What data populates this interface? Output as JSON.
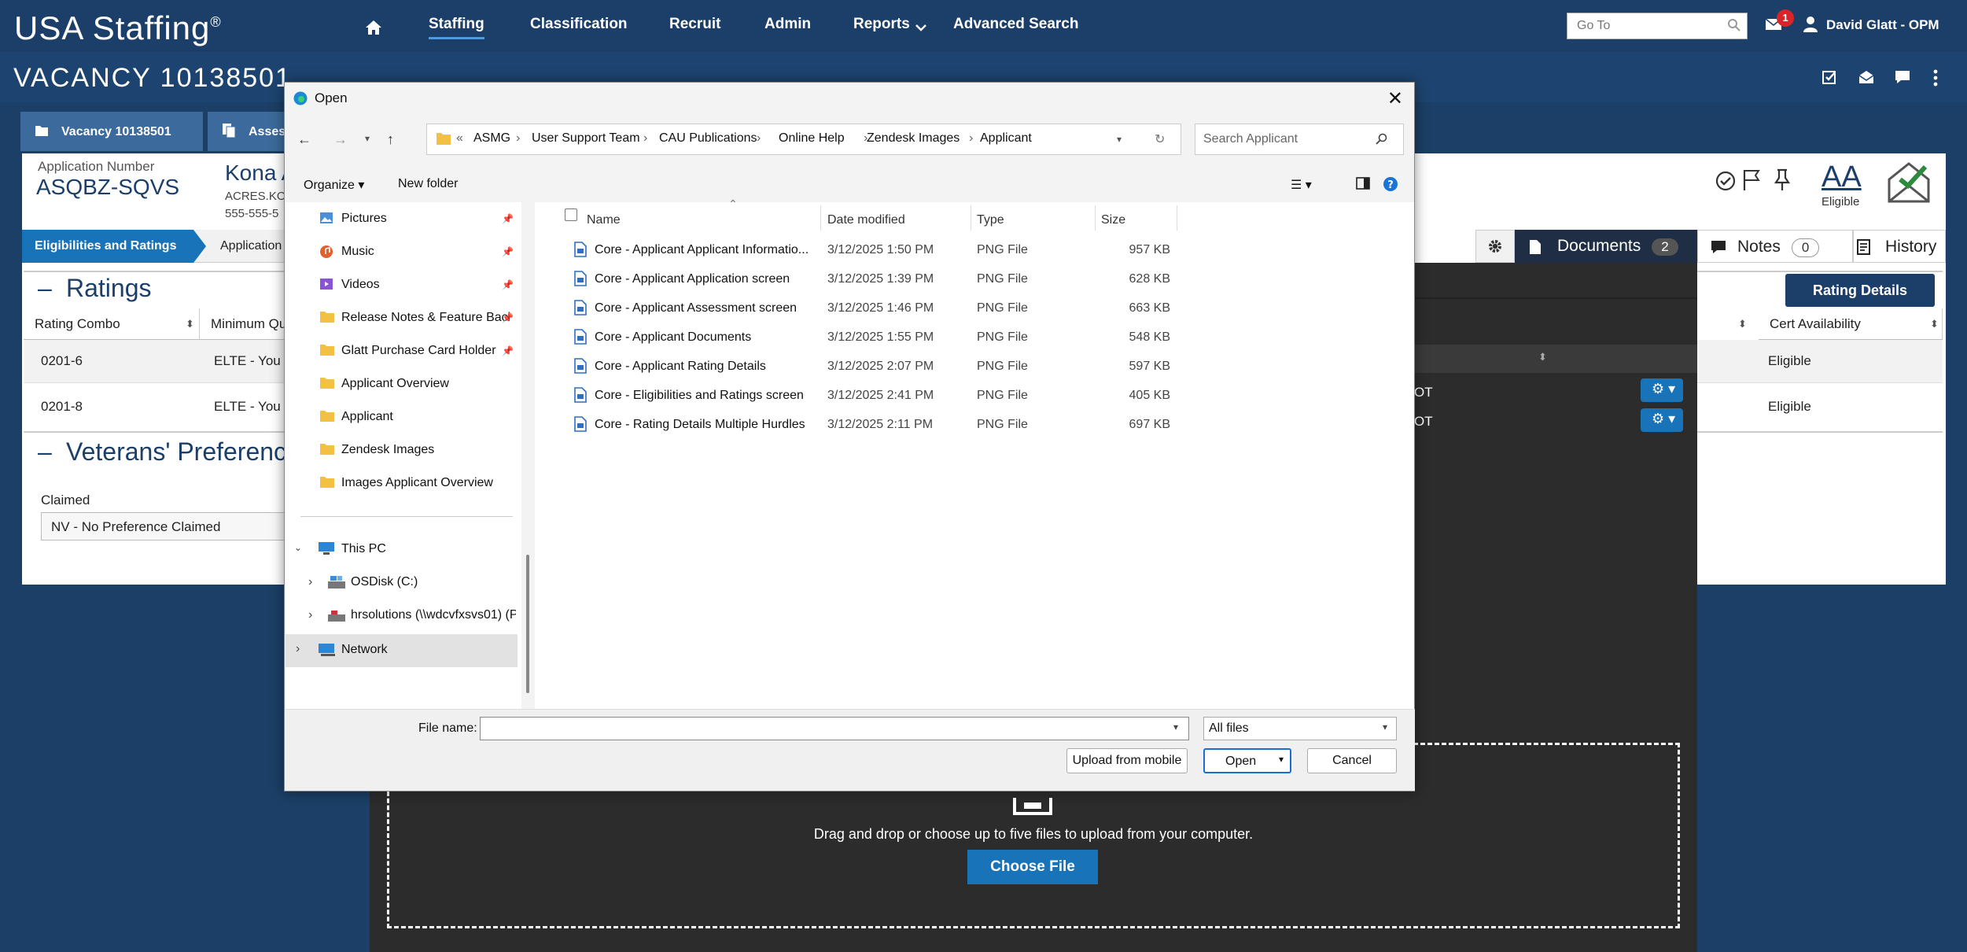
{
  "app": {
    "brand": "USA Staffing"
  },
  "nav": {
    "items": [
      "Staffing",
      "Classification",
      "Recruit",
      "Admin",
      "Reports",
      "Advanced Search"
    ],
    "goto_placeholder": "Go To",
    "mail_count": "1",
    "user": "David Glatt - OPM"
  },
  "vacancy": {
    "title": "VACANCY 10138501"
  },
  "tabs": {
    "vacancy": "Vacancy 10138501",
    "assess": "Asses"
  },
  "applicant": {
    "app_number_label": "Application Number",
    "app_number": "ASQBZ-SQVS",
    "name": "Kona A",
    "email": "ACRES.KO",
    "phone": "555-555-5",
    "eligibility": "Eligible",
    "aa": "AA"
  },
  "steps": {
    "active": "Eligibilities and Ratings",
    "next": "Application"
  },
  "side_tabs": {
    "documents": "Documents",
    "documents_count": "2",
    "notes": "Notes",
    "notes_count": "0",
    "history": "History"
  },
  "ratings": {
    "title": "Ratings",
    "columns": [
      "Rating Combo",
      "Minimum Qu",
      "Cert Availability"
    ],
    "rows": [
      {
        "combo": "0201-6",
        "min": "ELTE - You a",
        "tail": "OT",
        "cert": "Eligible"
      },
      {
        "combo": "0201-8",
        "min": "ELTE - You a",
        "tail": "OT",
        "cert": "Eligible"
      }
    ],
    "details_button": "Rating Details"
  },
  "veterans": {
    "title": "Veterans' Preferenc",
    "claimed_label": "Claimed",
    "claimed_value": "NV - No Preference Claimed"
  },
  "upload": {
    "drop_text": "Drag and drop or choose up to five files to upload from your computer.",
    "choose_label": "Choose File"
  },
  "dialog": {
    "title": "Open",
    "breadcrumb": [
      "ASMG",
      "User Support Team",
      "CAU Publications",
      "Online Help",
      "Zendesk Images",
      "Applicant"
    ],
    "search_placeholder": "Search Applicant",
    "organize": "Organize",
    "new_folder": "New folder",
    "tree": [
      {
        "label": "Pictures",
        "icon": "pictures-icon",
        "pinned": true
      },
      {
        "label": "Music",
        "icon": "music-icon",
        "pinned": true
      },
      {
        "label": "Videos",
        "icon": "videos-icon",
        "pinned": true
      },
      {
        "label": "Release Notes & Feature Bacl",
        "icon": "folder-icon",
        "pinned": true
      },
      {
        "label": "Glatt Purchase Card Holder",
        "icon": "folder-icon",
        "pinned": true
      },
      {
        "label": "Applicant Overview",
        "icon": "folder-icon",
        "pinned": false
      },
      {
        "label": "Applicant",
        "icon": "folder-icon",
        "pinned": false
      },
      {
        "label": "Zendesk Images",
        "icon": "folder-icon",
        "pinned": false
      },
      {
        "label": "Images Applicant Overview",
        "icon": "folder-icon",
        "pinned": false
      }
    ],
    "this_pc": "This PC",
    "drives": [
      "OSDisk (C:)",
      "hrsolutions (\\\\wdcvfxsvs01) (P"
    ],
    "network": "Network",
    "columns": [
      "Name",
      "Date modified",
      "Type",
      "Size"
    ],
    "files": [
      {
        "name": "Core - Applicant Applicant Informatio...",
        "date": "3/12/2025 1:50 PM",
        "type": "PNG File",
        "size": "957 KB"
      },
      {
        "name": "Core - Applicant Application screen",
        "date": "3/12/2025 1:39 PM",
        "type": "PNG File",
        "size": "628 KB"
      },
      {
        "name": "Core - Applicant Assessment screen",
        "date": "3/12/2025 1:46 PM",
        "type": "PNG File",
        "size": "663 KB"
      },
      {
        "name": "Core - Applicant Documents",
        "date": "3/12/2025 1:55 PM",
        "type": "PNG File",
        "size": "548 KB"
      },
      {
        "name": "Core - Applicant Rating Details",
        "date": "3/12/2025 2:07 PM",
        "type": "PNG File",
        "size": "597 KB"
      },
      {
        "name": "Core - Eligibilities and Ratings screen",
        "date": "3/12/2025 2:41 PM",
        "type": "PNG File",
        "size": "405 KB"
      },
      {
        "name": "Core - Rating Details Multiple Hurdles",
        "date": "3/12/2025 2:11 PM",
        "type": "PNG File",
        "size": "697 KB"
      }
    ],
    "filename_label": "File name:",
    "filename_value": "",
    "filter": "All files",
    "upload_mobile": "Upload from mobile",
    "open": "Open",
    "cancel": "Cancel"
  }
}
